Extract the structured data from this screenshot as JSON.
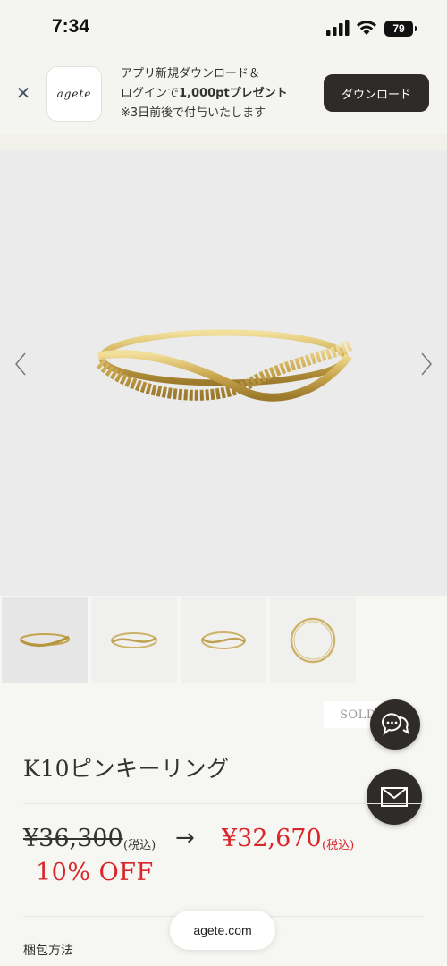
{
  "status": {
    "time": "7:34",
    "battery": "79"
  },
  "banner": {
    "app_logo_text": "agete",
    "line1": "アプリ新規ダウンロード＆",
    "line2_prefix": "ログインで",
    "line2_bold": "1,000ptプレゼント",
    "line3": "※3日前後で付与いたします",
    "download_label": "ダウンロード"
  },
  "gallery": {
    "image_count": 4,
    "active_index": 0
  },
  "product": {
    "sold_out_label": "SOLD",
    "title": "K10ピンキーリング",
    "old_price": "¥36,300",
    "old_tax": "(税込)",
    "new_price": "¥32,670",
    "new_tax": "(税込)",
    "discount": "10% OFF",
    "wrapping_label": "梱包方法"
  },
  "browser": {
    "url": "agete.com"
  },
  "colors": {
    "accent_red": "#d8262a",
    "dark_button": "#2f2b29"
  }
}
